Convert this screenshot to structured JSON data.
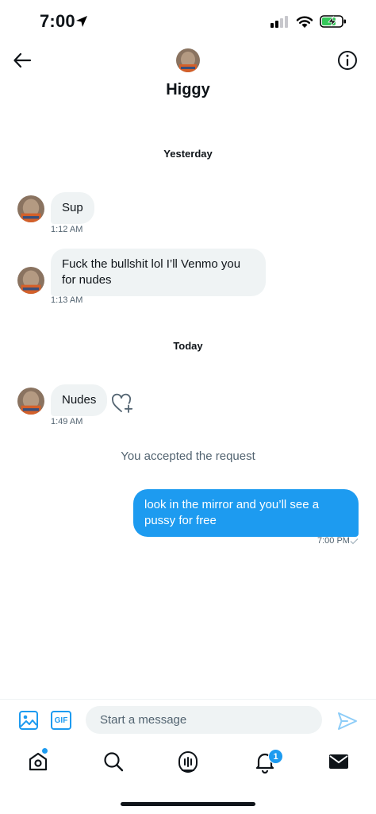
{
  "status_bar": {
    "time": "7:00"
  },
  "header": {
    "contact_name": "Higgy"
  },
  "conversation": {
    "day_separators": [
      "Yesterday",
      "Today"
    ],
    "messages": [
      {
        "direction": "incoming",
        "text": "Sup",
        "time": "1:12 AM"
      },
      {
        "direction": "incoming",
        "text": "Fuck the bullshit lol I’ll Venmo you for nudes",
        "time": "1:13 AM"
      },
      {
        "direction": "incoming",
        "text": "Nudes",
        "time": "1:49 AM"
      },
      {
        "direction": "outgoing",
        "text": "look in the mirror and you’ll see a pussy for free",
        "time": "7:00 PM"
      }
    ],
    "system_note": "You accepted the request"
  },
  "composer": {
    "gif_label": "GIF",
    "placeholder": "Start a message"
  },
  "tab_bar": {
    "items": [
      {
        "icon": "home-icon"
      },
      {
        "icon": "search-icon"
      },
      {
        "icon": "spaces-icon"
      },
      {
        "icon": "notifications-icon",
        "badge": "1"
      },
      {
        "icon": "messages-icon"
      }
    ]
  },
  "colors": {
    "accent": "#1d9bf0",
    "incoming_bubble": "#eff3f4",
    "text": "#0f1419",
    "secondary_text": "#536471"
  }
}
